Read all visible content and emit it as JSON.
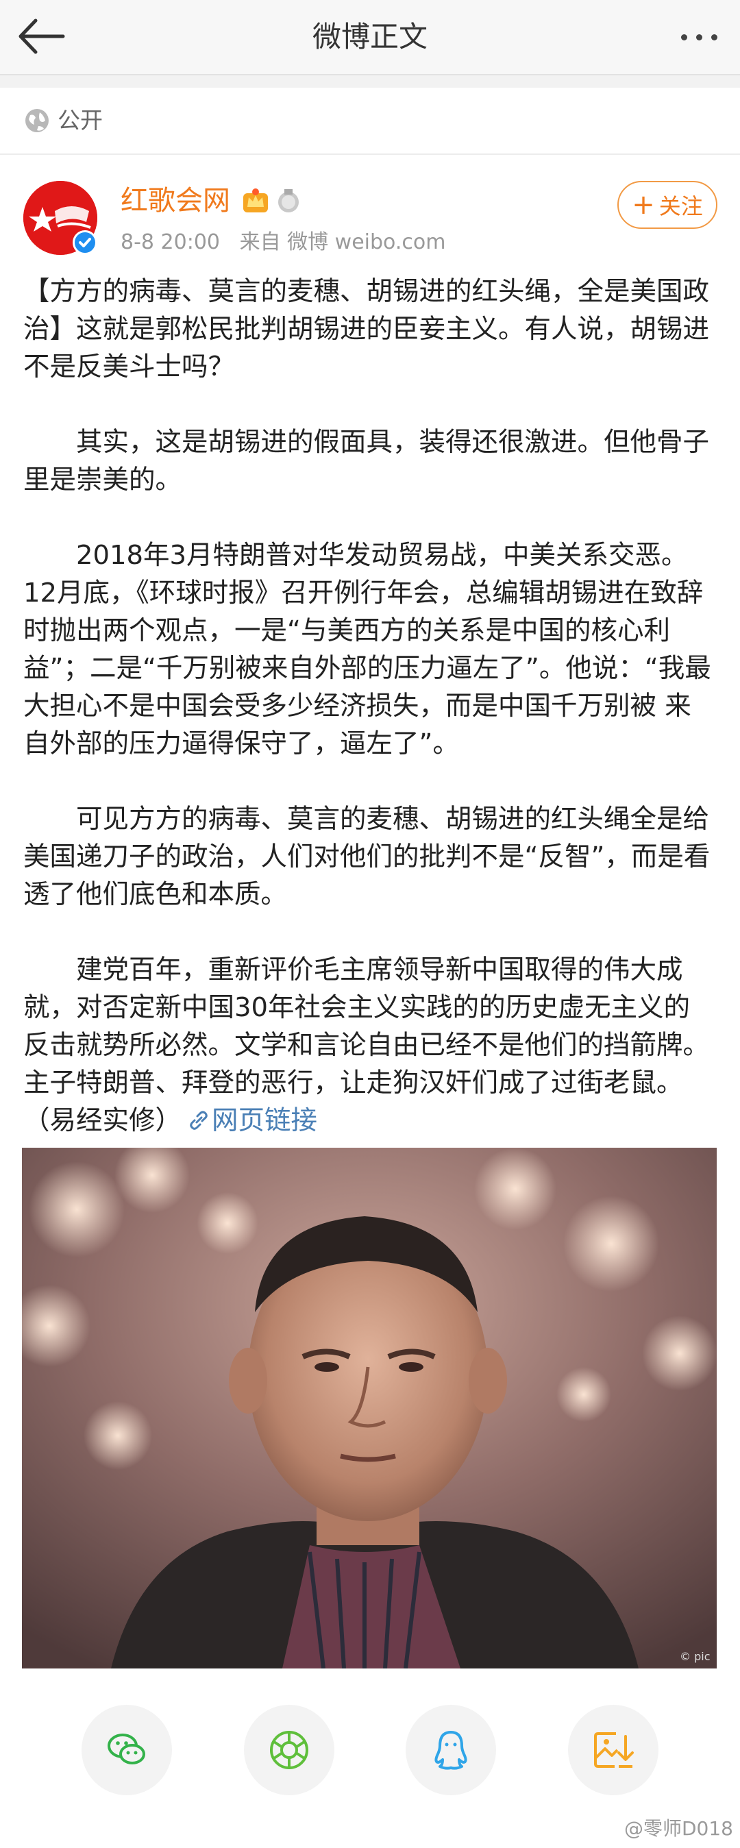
{
  "header": {
    "title": "微博正文",
    "back_icon": "back-arrow-icon",
    "more_icon": "more-dots-icon"
  },
  "privacy": {
    "icon": "globe-icon",
    "label": "公开"
  },
  "post": {
    "author": "红歌会网",
    "time": "8-8 20:00",
    "source": "来自 微博 weibo.com",
    "follow_label": "关注",
    "follow_plus": "+",
    "paragraphs": [
      "【方方的病毒、莫言的麦穗、胡锡进的红头绳，全是美国政治】这就是郭松民批判胡锡进的臣妾主义。有人说，胡锡进不是反美斗士吗？",
      "其实，这是胡锡进的假面具，装得还很激进。但他骨子里是崇美的。",
      "2018年3月特朗普对华发动贸易战，中美关系交恶。12月底，《环球时报》召开例行年会，总编辑胡锡进在致辞时抛出两个观点，一是“与美西方的关系是中国的核心利益”；二是“千万别被来自外部的压力逼左了”。他说：“我最大担心不是中国会受多少经济损失，而是中国千万别被 来自外部的压力逼得保守了，逼左了”。",
      "可见方方的病毒、莫言的麦穗、胡锡进的红头绳全是给美国递刀子的政治，人们对他们的批判不是“反智”，而是看透了他们底色和本质。",
      "建党百年，重新评价毛主席领导新中国取得的伟大成就，对否定新中国30年社会主义实践的的历史虚无主义的反击就势所必然。文学和言论自由已经不是他们的挡箭牌。主子特朗普、拜登的恶行，让走狗汉奸们成了过街老鼠。（易经实修）"
    ],
    "link_label": "网页链接",
    "photo_caption": "© pic"
  },
  "share": [
    "wechat-icon",
    "moments-icon",
    "qq-icon",
    "save-image-icon"
  ],
  "watermark": "@零师D018",
  "colors": {
    "accent": "#f07a1d",
    "link": "#4a7fb5",
    "verified": "#1e8ef0"
  }
}
